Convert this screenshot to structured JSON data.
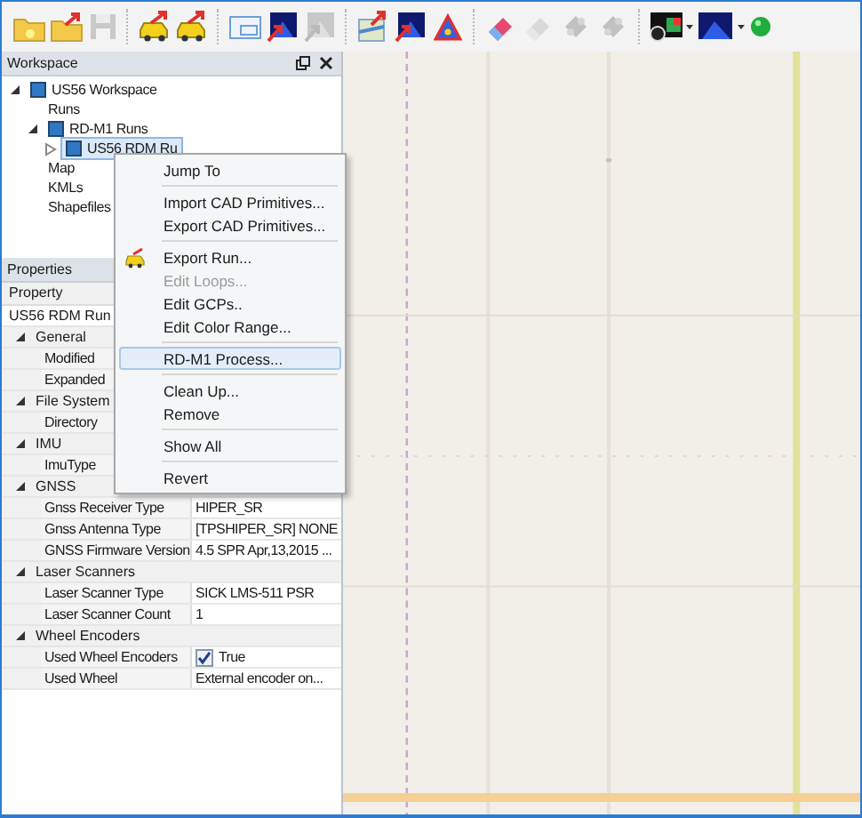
{
  "toolbar": [
    {
      "kind": "new-folder",
      "disabled": false
    },
    {
      "kind": "open-folder",
      "disabled": false
    },
    {
      "kind": "save",
      "disabled": true
    },
    {
      "kind": "separator"
    },
    {
      "kind": "car",
      "disabled": false
    },
    {
      "kind": "car",
      "disabled": false
    },
    {
      "kind": "separator"
    },
    {
      "kind": "window",
      "disabled": false
    },
    {
      "kind": "scene",
      "disabled": false
    },
    {
      "kind": "scene",
      "disabled": true
    },
    {
      "kind": "separator"
    },
    {
      "kind": "map",
      "disabled": false
    },
    {
      "kind": "scene",
      "disabled": false
    },
    {
      "kind": "triangle",
      "disabled": false
    },
    {
      "kind": "separator"
    },
    {
      "kind": "eraser",
      "disabled": false
    },
    {
      "kind": "eraser",
      "disabled": true
    },
    {
      "kind": "puzzle",
      "disabled": true
    },
    {
      "kind": "puzzle",
      "disabled": true
    },
    {
      "kind": "separator"
    },
    {
      "kind": "chart-dropdown",
      "disabled": false
    },
    {
      "kind": "scene-dropdown",
      "disabled": false
    },
    {
      "kind": "status"
    }
  ],
  "workspace": {
    "title": "Workspace",
    "tree": [
      {
        "label": "US56 Workspace",
        "kind": "project",
        "expanded": true,
        "selected": false,
        "children": [
          {
            "label": "Runs",
            "kind": "item",
            "selected": false
          },
          {
            "label": "RD-M1 Runs",
            "kind": "group",
            "expanded": true,
            "selected": false,
            "children": [
              {
                "label": "US56 RDM Ru",
                "kind": "run",
                "expanded": false,
                "selected": true
              }
            ]
          },
          {
            "label": "Map",
            "kind": "item",
            "selected": false
          },
          {
            "label": "KMLs",
            "kind": "item",
            "selected": false
          },
          {
            "label": "Shapefiles",
            "kind": "item",
            "selected": false
          }
        ]
      }
    ]
  },
  "properties": {
    "title": "Properties",
    "header": "Property",
    "rows": [
      {
        "kind": "object",
        "label": "US56 RDM Run"
      },
      {
        "kind": "category",
        "label": "General",
        "expanded": true
      },
      {
        "kind": "property",
        "label": "Modified"
      },
      {
        "kind": "property",
        "label": "Expanded"
      },
      {
        "kind": "category",
        "label": "File System",
        "expanded": true
      },
      {
        "kind": "property",
        "label": "Directory"
      },
      {
        "kind": "category",
        "label": "IMU",
        "expanded": true
      },
      {
        "kind": "property",
        "label": "ImuType"
      },
      {
        "kind": "category",
        "label": "GNSS",
        "expanded": true
      },
      {
        "kind": "property",
        "label": "Gnss Receiver Type",
        "value": "HIPER_SR"
      },
      {
        "kind": "property",
        "label": "Gnss Antenna Type",
        "value": "[TPSHIPER_SR] NONE"
      },
      {
        "kind": "property",
        "label": "GNSS Firmware Version",
        "value": "4.5 SPR Apr,13,2015 ..."
      },
      {
        "kind": "category",
        "label": "Laser Scanners",
        "expanded": true
      },
      {
        "kind": "property",
        "label": "Laser Scanner Type",
        "value": "SICK LMS-511 PSR"
      },
      {
        "kind": "property",
        "label": "Laser Scanner Count",
        "value": "1"
      },
      {
        "kind": "category",
        "label": "Wheel Encoders",
        "expanded": true
      },
      {
        "kind": "property",
        "label": "Used Wheel Encoders",
        "value": "True",
        "checked": true
      },
      {
        "kind": "property",
        "label": "Used Wheel",
        "value": "External encoder on..."
      }
    ]
  },
  "context_menu": [
    {
      "kind": "item",
      "label": "Jump To",
      "disabled": false,
      "selected": false
    },
    {
      "kind": "separator"
    },
    {
      "kind": "item",
      "label": "Import CAD Primitives...",
      "disabled": false,
      "selected": false
    },
    {
      "kind": "item",
      "label": "Export CAD Primitives...",
      "disabled": false,
      "selected": false
    },
    {
      "kind": "separator"
    },
    {
      "kind": "icon-item",
      "label": "Export Run...",
      "disabled": false,
      "selected": false
    },
    {
      "kind": "item",
      "label": "Edit Loops...",
      "disabled": true,
      "selected": false
    },
    {
      "kind": "item",
      "label": "Edit GCPs..",
      "disabled": false,
      "selected": false
    },
    {
      "kind": "item",
      "label": "Edit Color Range...",
      "disabled": false,
      "selected": false
    },
    {
      "kind": "separator"
    },
    {
      "kind": "item",
      "label": "RD-M1 Process...",
      "disabled": false,
      "selected": true
    },
    {
      "kind": "separator"
    },
    {
      "kind": "item",
      "label": "Clean Up...",
      "disabled": false,
      "selected": false
    },
    {
      "kind": "item",
      "label": "Remove",
      "disabled": false,
      "selected": false
    },
    {
      "kind": "separator"
    },
    {
      "kind": "item",
      "label": "Show All",
      "disabled": false,
      "selected": false
    },
    {
      "kind": "separator"
    },
    {
      "kind": "item",
      "label": "Revert",
      "disabled": false,
      "selected": false
    }
  ]
}
